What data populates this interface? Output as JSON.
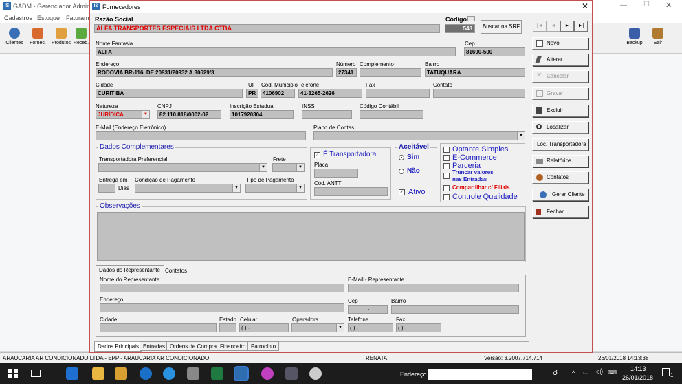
{
  "bg": {
    "title": "GADM - Gerenciador Administrativo",
    "menu": [
      "Cadastros",
      "Estoque",
      "Faturamento"
    ],
    "toolbar": [
      "Clientes",
      "Fornec.",
      "Produtos",
      "Receb."
    ],
    "right_toolbar": [
      "Backup",
      "Sair"
    ],
    "status": {
      "company": "ARAUCARIA AR CONDICIONADO LTDA - EPP - ARAUCARIA AR CONDICIONADO",
      "user": "RENATA",
      "version": "Versão: 3.2007.714.714",
      "datetime": "26/01/2018 14:13:38"
    }
  },
  "dialog": {
    "title": "Fornecedores",
    "razao_label": "Razão Social",
    "razao_value": "ALFA TRANSPORTES ESPECIAIS LTDA CTBA",
    "codigo_label": "Código",
    "codigo_value": "548",
    "buscar_label": "Buscar na SRF",
    "nav": [
      "|◄",
      "◄",
      "►",
      "►|"
    ],
    "fantasia_label": "Nome Fantasia",
    "fantasia_value": "ALFA",
    "cep_label": "Cep",
    "cep_value": "81690-500",
    "endereco_label": "Endereço",
    "endereco_value": "RODOVIA BR-116, DE 20931/20932 A 30629/3",
    "numero_label": "Número",
    "numero_value": "27341",
    "complemento_label": "Complemento",
    "complemento_value": "",
    "bairro_label": "Bairro",
    "bairro_value": "TATUQUARA",
    "cidade_label": "Cidade",
    "cidade_value": "CURITIBA",
    "uf_label": "UF",
    "uf_value": "PR",
    "codmun_label": "Cód. Municipio",
    "codmun_value": "4106902",
    "telefone_label": "Telefone",
    "telefone_value": "41-3265-2626",
    "fax_label": "Fax",
    "contato_label": "Contato",
    "natureza_label": "Natureza",
    "natureza_value": "JURÍDICA",
    "cnpj_label": "CNPJ",
    "cnpj_value": "82.110.818/0002-02",
    "ie_label": "Inscrição Estadual",
    "ie_value": "1017920304",
    "inss_label": "INSS",
    "contabil_label": "Código Contábil",
    "email_label": "E-Mail (Endereço Eletrônico)",
    "plano_label": "Plano de Contas",
    "dados_comp": "Dados Complementares",
    "transp_pref_label": "Transportadora Preferencial",
    "frete_label": "Frete",
    "entrega_label": "Entrega em",
    "dias_label": "Dias",
    "condpag_label": "Condição de Pagamento",
    "tipopag_label": "Tipo de Pagamento",
    "e_transp": "É Transportadora",
    "placa_label": "Placa",
    "antt_label": "Cód. ANTT",
    "aceitavel": "Aceitável",
    "sim": "Sim",
    "nao": "Não",
    "ativo": "Ativo",
    "checks": [
      "Optante Simples",
      "E-Commerce",
      "Parceria",
      "Truncar valores nas Entradas",
      "Compartilhar c/ Filiais",
      "Controle Qualidade"
    ],
    "obs": "Observações",
    "subtabs": [
      "Dados do Representante",
      "Contatos"
    ],
    "rep": {
      "nome": "Nome do Representante",
      "email": "E-Mail - Representante",
      "endereco": "Endereço",
      "cep": "Cep",
      "cep_value": "-",
      "bairro": "Bairro",
      "cidade": "Cidade",
      "estado": "Estado",
      "celular": "Celular",
      "celular_value": "(  )    -",
      "operadora": "Operadora",
      "telefone": "Telefone",
      "telefone_value": "(  )    -",
      "fax": "Fax",
      "fax_value": "(  )    -"
    },
    "bottom_tabs": [
      "Dados Principais",
      "Entradas",
      "Ordens de Compra",
      "Financeiro",
      "Patrocínio"
    ],
    "buttons": [
      "Novo",
      "Alterar",
      "Cancelar",
      "Gravar",
      "Excluir",
      "Localizar",
      "Loc. Transportadora",
      "Relatórios",
      "Contatos",
      "Gerar Cliente",
      "Fechar"
    ]
  },
  "taskbar": {
    "search": "Endereço",
    "time": "14:13",
    "date": "26/01/2018",
    "notif": "1"
  }
}
